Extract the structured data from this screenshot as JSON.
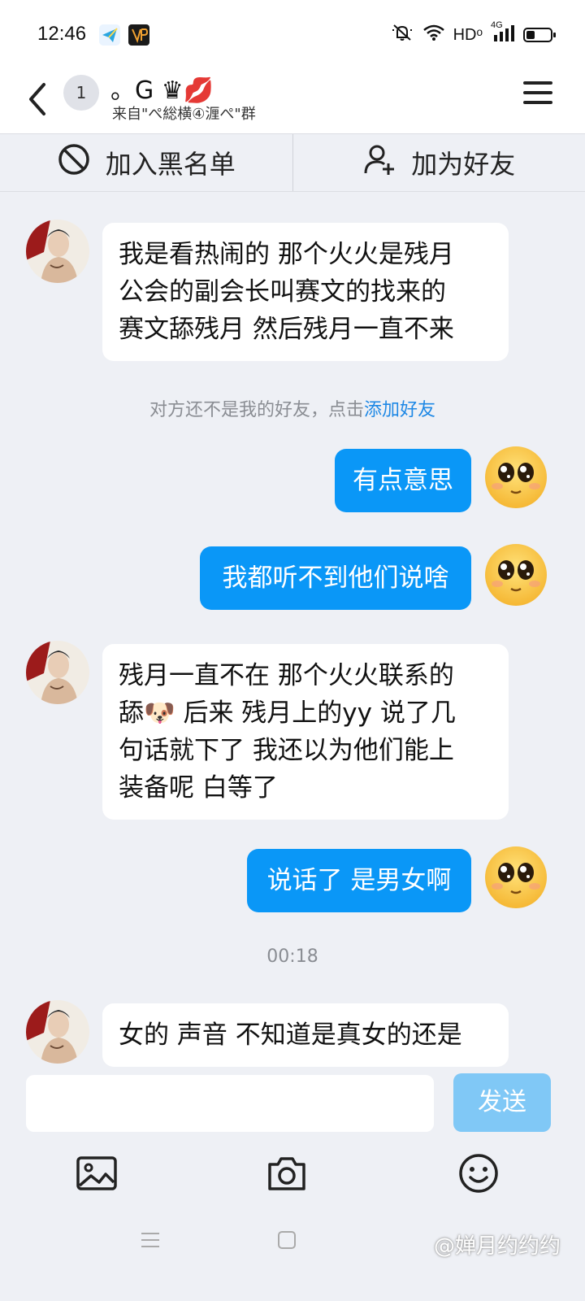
{
  "status_bar": {
    "time": "12:46",
    "network_label": "HDᵒ",
    "signal_label": "4G"
  },
  "header": {
    "unread_count": "1",
    "title": "。G ♛💋",
    "subtitle": "来自\"ぺ総横④湹ぺ\"群"
  },
  "actions": {
    "blacklist_label": "加入黑名单",
    "add_friend_label": "加为好友"
  },
  "messages": [
    {
      "side": "in",
      "text_lines": [
        "我是看热闹的  那个火火是残月",
        "公会的副会长叫赛文的找来的",
        "赛文舔残月 然后残月一直不来"
      ]
    },
    {
      "side": "out",
      "text": "有点意思"
    },
    {
      "side": "out",
      "text": "我都听不到他们说啥"
    },
    {
      "side": "in",
      "text_lines": [
        "残月一直不在  那个火火联系的",
        "舔🐶  后来 残月上的yy   说了几",
        "句话就下了  我还以为他们能上",
        "装备呢    白等了"
      ]
    },
    {
      "side": "out",
      "text": "说话了 是男女啊"
    },
    {
      "side": "in",
      "text_lines": [
        "女的 声音   不知道是真女的还是"
      ]
    }
  ],
  "notice": {
    "text": "对方还不是我的好友，点击",
    "link": "添加好友"
  },
  "timestamp": "00:18",
  "input": {
    "value": "",
    "send_label": "发送"
  },
  "watermark": "@婵月约约约",
  "colors": {
    "outgoing_bubble": "#0a97f7",
    "link": "#1e88e5",
    "send_disabled": "#80c8f6"
  }
}
